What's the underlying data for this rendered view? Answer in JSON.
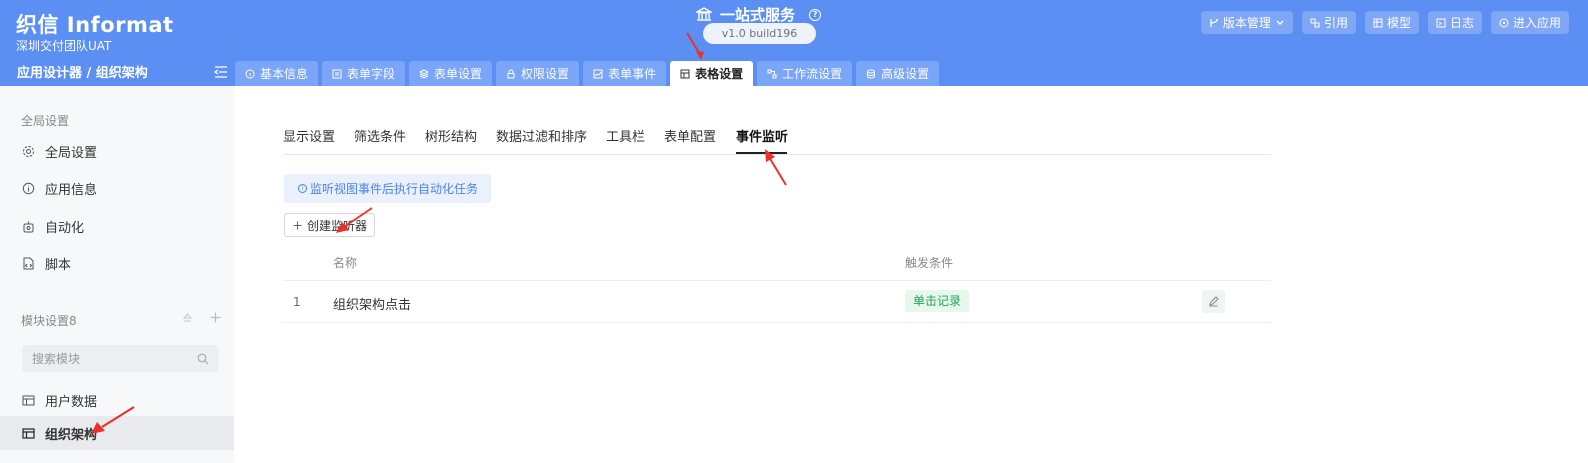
{
  "header": {
    "logo": "织信 Informat",
    "team": "深圳交付团队UAT",
    "breadcrumb": "应用设计器 / 组织架构",
    "center_title": "一站式服务",
    "version": "v1.0 build196",
    "actions": [
      {
        "label": "版本管理",
        "icon": "branch-icon"
      },
      {
        "label": "引用",
        "icon": "reference-icon"
      },
      {
        "label": "模型",
        "icon": "model-icon"
      },
      {
        "label": "日志",
        "icon": "log-icon"
      },
      {
        "label": "进入应用",
        "icon": "enter-icon"
      }
    ],
    "tabs": [
      {
        "label": "基本信息",
        "icon": "info-icon"
      },
      {
        "label": "表单字段",
        "icon": "form-field-icon"
      },
      {
        "label": "表单设置",
        "icon": "layers-icon"
      },
      {
        "label": "权限设置",
        "icon": "lock-icon"
      },
      {
        "label": "表单事件",
        "icon": "event-icon"
      },
      {
        "label": "表格设置",
        "icon": "table-icon"
      },
      {
        "label": "工作流设置",
        "icon": "workflow-icon"
      },
      {
        "label": "高级设置",
        "icon": "database-icon"
      }
    ]
  },
  "sidebar": {
    "global_section": "全局设置",
    "global_items": [
      {
        "label": "全局设置",
        "icon": "gear-icon"
      },
      {
        "label": "应用信息",
        "icon": "info-icon"
      },
      {
        "label": "自动化",
        "icon": "automation-icon"
      },
      {
        "label": "脚本",
        "icon": "script-icon"
      }
    ],
    "module_section": "模块设置8",
    "search_placeholder": "搜索模块",
    "modules": [
      {
        "label": "用户数据",
        "icon": "table-icon"
      },
      {
        "label": "组织架构",
        "icon": "table-icon"
      }
    ]
  },
  "main": {
    "subtabs": [
      "显示设置",
      "筛选条件",
      "树形结构",
      "数据过滤和排序",
      "工具栏",
      "表单配置",
      "事件监听"
    ],
    "info_text": "监听视图事件后执行自动化任务",
    "create_button": "创建监听器",
    "table": {
      "headers": [
        "名称",
        "触发条件"
      ],
      "rows": [
        {
          "index": "1",
          "name": "组织架构点击",
          "trigger": "单击记录"
        }
      ]
    }
  },
  "colors": {
    "header_bg": "#5b8ff4",
    "accent": "#4d82ee",
    "tag_green": "#22a35a",
    "annotation_red": "#e8332a"
  }
}
